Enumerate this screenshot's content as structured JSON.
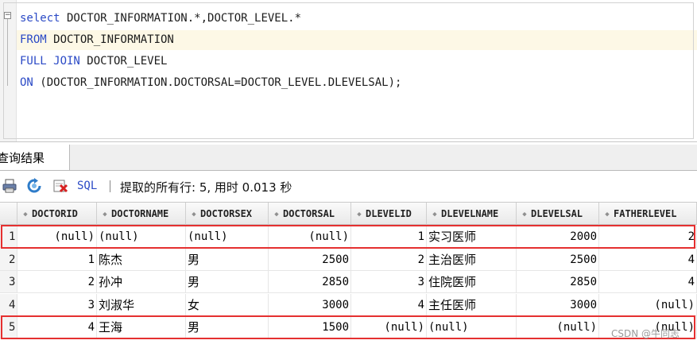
{
  "editor": {
    "lines": [
      [
        {
          "t": "select",
          "k": "kw"
        },
        {
          "t": " DOCTOR_INFORMATION.*,DOCTOR_LEVEL.*",
          "k": "txt"
        }
      ],
      [
        {
          "t": "FROM",
          "k": "kw"
        },
        {
          "t": " DOCTOR_INFORMATION",
          "k": "txt"
        }
      ],
      [
        {
          "t": "FULL JOIN",
          "k": "kw"
        },
        {
          "t": " DOCTOR_LEVEL",
          "k": "txt"
        }
      ],
      [
        {
          "t": "ON",
          "k": "kw"
        },
        {
          "t": " (DOCTOR_INFORMATION.DOCTORSAL=DOCTOR_LEVEL.DLEVELSAL);",
          "k": "txt"
        }
      ]
    ],
    "fold_symbol": "−"
  },
  "results_tab": {
    "label": "查询结果"
  },
  "toolbar": {
    "sql_label": "SQL",
    "separator": "|",
    "status": "提取的所有行: 5, 用时 0.013 秒"
  },
  "grid": {
    "sort_glyph": "◆",
    "columns": [
      "DOCTORID",
      "DOCTORNAME",
      "DOCTORSEX",
      "DOCTORSAL",
      "DLEVELID",
      "DLEVELNAME",
      "DLEVELSAL",
      "FATHERLEVEL"
    ],
    "rows": [
      {
        "n": "1",
        "cells": [
          "(null)",
          "(null)",
          "(null)",
          "(null)",
          "1",
          "实习医师",
          "2000",
          "2"
        ]
      },
      {
        "n": "2",
        "cells": [
          "1",
          "陈杰",
          "男",
          "2500",
          "2",
          "主治医师",
          "2500",
          "4"
        ]
      },
      {
        "n": "3",
        "cells": [
          "2",
          "孙冲",
          "男",
          "2850",
          "3",
          "住院医师",
          "2850",
          "4"
        ]
      },
      {
        "n": "4",
        "cells": [
          "3",
          "刘淑华",
          "女",
          "3000",
          "4",
          "主任医师",
          "3000",
          "(null)"
        ]
      },
      {
        "n": "5",
        "cells": [
          "4",
          "王海",
          "男",
          "1500",
          "(null)",
          "(null)",
          "(null)",
          "(null)"
        ]
      }
    ],
    "highlighted_rows": [
      "1",
      "5"
    ],
    "highlight_color": "#e53030"
  },
  "watermark": "CSDN @牛同志"
}
